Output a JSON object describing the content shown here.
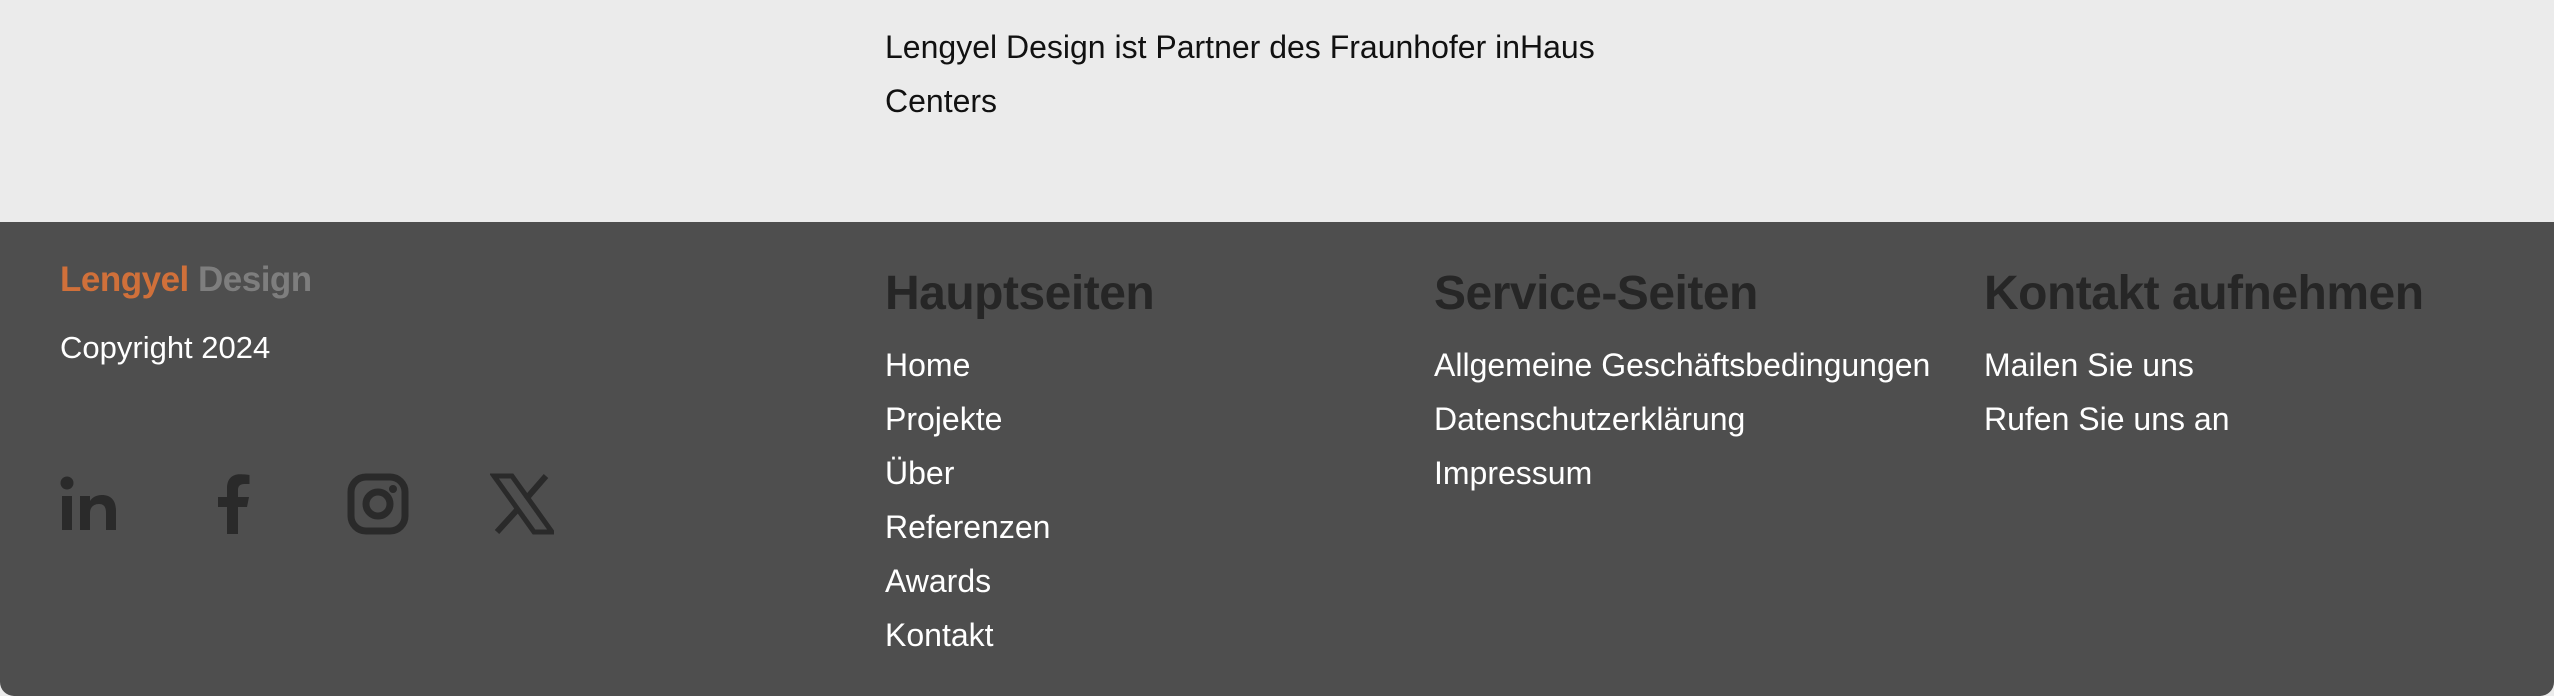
{
  "partner": {
    "line1": "Lengyel Design ist Partner des Fraunhofer inHaus",
    "line2": "Centers"
  },
  "footer": {
    "brand": {
      "part1": "Lengyel",
      "part2": "Design"
    },
    "copyright": "Copyright 2024",
    "socials": [
      {
        "icon": "linkedin-icon"
      },
      {
        "icon": "facebook-icon"
      },
      {
        "icon": "instagram-icon"
      },
      {
        "icon": "x-twitter-icon"
      }
    ],
    "columns": {
      "main": {
        "heading": "Hauptseiten",
        "links": [
          "Home",
          "Projekte",
          "Über",
          "Referenzen",
          "Awards",
          "Kontakt"
        ]
      },
      "service": {
        "heading": "Service-Seiten",
        "links": [
          "Allgemeine Geschäftsbedingungen",
          "Datenschutzerklärung",
          "Impressum"
        ]
      },
      "contact": {
        "heading": "Kontakt aufnehmen",
        "links": [
          "Mailen Sie uns",
          "Rufen Sie uns an"
        ]
      }
    },
    "colors": {
      "background": "#4e4e4e",
      "brand_accent": "#d0703a",
      "brand_muted": "#7e7e7e",
      "heading": "#262626",
      "icon": "#2a2a2a"
    }
  }
}
